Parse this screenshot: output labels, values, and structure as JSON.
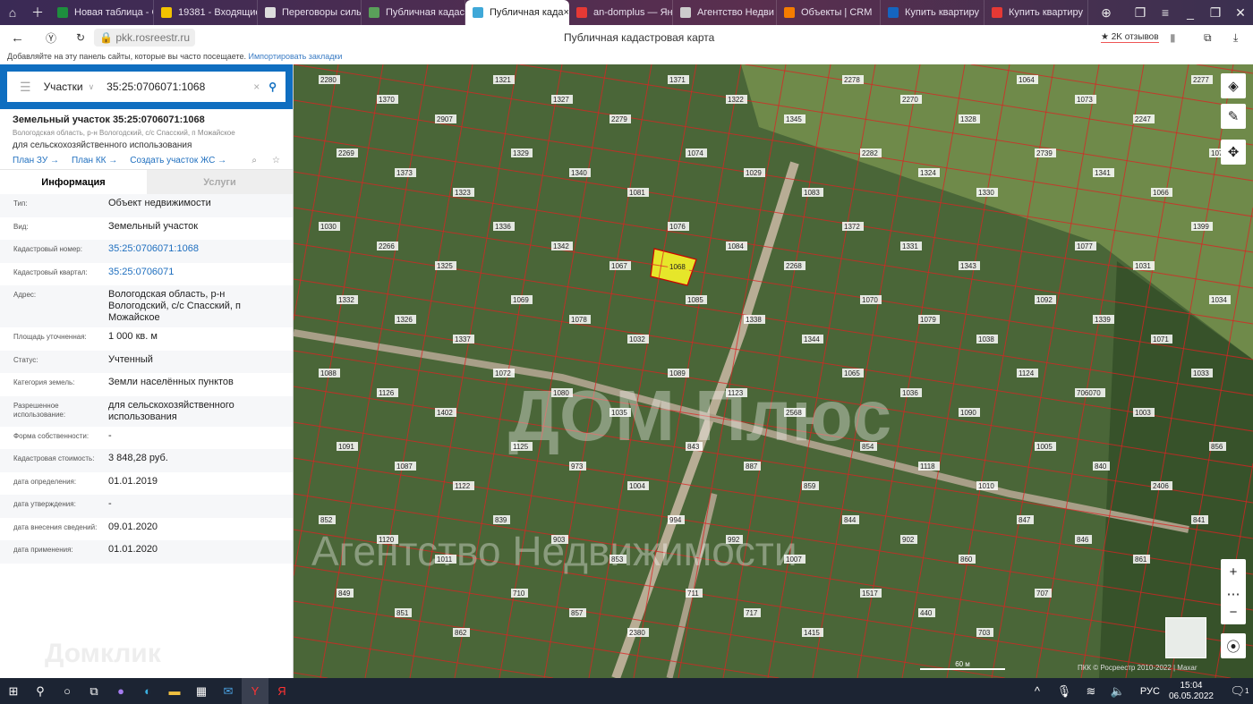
{
  "browser": {
    "tabs": [
      {
        "label": "Новая таблица - G",
        "color": "#1e8e3e"
      },
      {
        "label": "19381 - Входящие",
        "color": "#f2c200"
      },
      {
        "label": "Переговоры силы",
        "color": "#ddd"
      },
      {
        "label": "Публичная кадаст",
        "color": "#5aa05a"
      },
      {
        "label": "Публичная када",
        "color": "#3fa8d8",
        "active": true
      },
      {
        "label": "an-domplus — Ян",
        "color": "#e53935"
      },
      {
        "label": "Агентство Недви",
        "color": "#ccc"
      },
      {
        "label": "Объекты | CRM",
        "color": "#f57c00"
      },
      {
        "label": "Купить квартиру",
        "color": "#1565c0"
      },
      {
        "label": "Купить квартиру",
        "color": "#e53935"
      }
    ],
    "url": "pkk.rosreestr.ru",
    "page_title": "Публичная кадастровая карта",
    "reviews": "★ 2K отзывов",
    "bookmarks_hint": "Добавляйте на эту панель сайты, которые вы часто посещаете.",
    "import_bookmarks": "Импортировать закладки"
  },
  "search": {
    "type": "Участки",
    "value": "35:25:0706071:1068"
  },
  "parcel": {
    "title": "Земельный участок 35:25:0706071:1068",
    "address_short": "Вологодская область, р-н Вологодский, с/с Спасский, п Можайское",
    "use": "для сельскохозяйственного использования",
    "links": [
      "План ЗУ →",
      "План КК →",
      "Создать участок ЖС →"
    ],
    "tabs": [
      "Информация",
      "Услуги"
    ],
    "fields": [
      {
        "k": "Тип:",
        "v": "Объект недвижимости"
      },
      {
        "k": "Вид:",
        "v": "Земельный участок"
      },
      {
        "k": "Кадастровый номер:",
        "v": "35:25:0706071:1068",
        "link": true
      },
      {
        "k": "Кадастровый квартал:",
        "v": "35:25:0706071",
        "link": true
      },
      {
        "k": "Адрес:",
        "v": "Вологодская область, р-н Вологодский, с/с Спасский, п Можайское"
      },
      {
        "k": "Площадь уточненная:",
        "v": "1 000 кв. м"
      },
      {
        "k": "Статус:",
        "v": "Учтенный"
      },
      {
        "k": "Категория земель:",
        "v": "Земли населённых пунктов"
      },
      {
        "k": "Разрешенное использование:",
        "v": "для сельскохозяйственного использования"
      },
      {
        "k": "Форма собственности:",
        "v": "-"
      },
      {
        "k": "Кадастровая стоимость:",
        "v": "3 848,28 руб."
      },
      {
        "k": "дата определения:",
        "v": "01.01.2019"
      },
      {
        "k": "дата утверждения:",
        "v": "-"
      },
      {
        "k": "дата внесения сведений:",
        "v": "09.01.2020"
      },
      {
        "k": "дата применения:",
        "v": "01.01.2020"
      }
    ]
  },
  "watermark": "Домклик",
  "map": {
    "selected": "1068",
    "labels": [
      "2280",
      "1370",
      "2907",
      "1321",
      "1327",
      "2279",
      "1371",
      "1322",
      "1345",
      "2278",
      "2270",
      "1328",
      "1064",
      "1073",
      "2247",
      "2277",
      "2269",
      "1373",
      "1323",
      "1329",
      "1340",
      "1081",
      "1074",
      "1029",
      "1083",
      "2282",
      "1324",
      "1330",
      "2739",
      "1341",
      "1066",
      "1075",
      "1030",
      "2266",
      "1325",
      "1336",
      "1342",
      "1067",
      "1076",
      "1084",
      "2268",
      "1372",
      "1331",
      "1343",
      "1068",
      "1077",
      "1031",
      "1399",
      "1332",
      "1326",
      "1337",
      "1069",
      "1078",
      "1032",
      "1085",
      "1338",
      "1344",
      "1070",
      "1079",
      "1038",
      "1092",
      "1339",
      "1071",
      "1034",
      "1088",
      "1126",
      "1402",
      "1072",
      "1080",
      "1035",
      "1089",
      "1123",
      "2568",
      "1065",
      "1036",
      "1090",
      "1124",
      "706070",
      "1003",
      "1033",
      "1091",
      "1087",
      "1122",
      "1125",
      "973",
      "1004",
      "843",
      "887",
      "859",
      "854",
      "1118",
      "1010",
      "1005",
      "840",
      "2406",
      "856",
      "852",
      "1120",
      "1011",
      "839",
      "903",
      "853",
      "994",
      "992",
      "1007",
      "844",
      "902",
      "860",
      "847",
      "846",
      "861",
      "841",
      "849",
      "851",
      "862",
      "710",
      "857",
      "2380",
      "711",
      "717",
      "1415",
      "1517",
      "440",
      "703",
      "707"
    ],
    "scale": "60 м",
    "copyright": "ПКК © Росреестр 2010-2022 | Maxar"
  },
  "taskbar": {
    "lang": "РУС",
    "time": "15:04",
    "date": "06.05.2022",
    "notif": "1"
  }
}
